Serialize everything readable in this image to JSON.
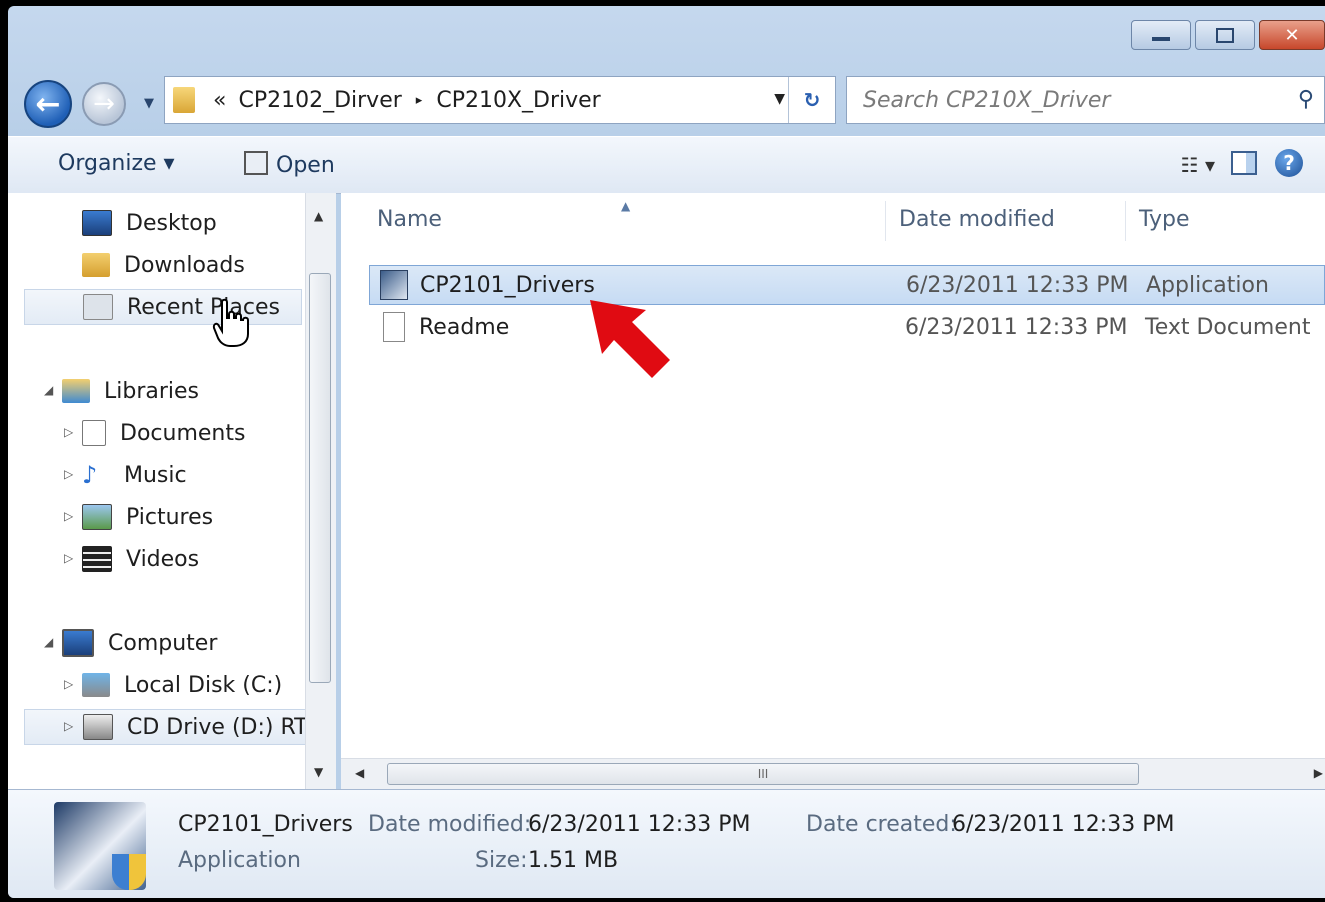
{
  "window": {
    "caption_buttons": {
      "minimize": "minimize",
      "maximize": "maximize",
      "close": "✕"
    }
  },
  "address_bar": {
    "overflow": "«",
    "crumbs": [
      "CP2102_Dirver",
      "CP210X_Driver"
    ],
    "separator": "▸"
  },
  "search": {
    "placeholder": "Search CP210X_Driver"
  },
  "toolbar": {
    "organize": "Organize ▾",
    "open": "Open",
    "help": "?"
  },
  "nav_pane": {
    "favorites": [
      {
        "label": "Desktop",
        "icon": "desktop-icon"
      },
      {
        "label": "Downloads",
        "icon": "downloads-icon"
      },
      {
        "label": "Recent Places",
        "icon": "recent-places-icon"
      }
    ],
    "libraries": {
      "label": "Libraries",
      "items": [
        "Documents",
        "Music",
        "Pictures",
        "Videos"
      ]
    },
    "computer": {
      "label": "Computer",
      "items": [
        "Local Disk (C:)",
        "CD Drive (D:) RTN"
      ]
    }
  },
  "columns": {
    "name": "Name",
    "date": "Date modified",
    "type": "Type"
  },
  "files": [
    {
      "name": "CP2101_Drivers",
      "date": "6/23/2011 12:33 PM",
      "type": "Application",
      "icon": "application-icon",
      "selected": true
    },
    {
      "name": "Readme",
      "date": "6/23/2011 12:33 PM",
      "type": "Text Document",
      "icon": "text-document-icon",
      "selected": false
    }
  ],
  "details": {
    "name": "CP2101_Drivers",
    "type": "Application",
    "date_modified_label": "Date modified:",
    "date_modified": "6/23/2011 12:33 PM",
    "date_created_label": "Date created:",
    "date_created": "6/23/2011 12:33 PM",
    "size_label": "Size:",
    "size": "1.51 MB"
  },
  "scrollbar": {
    "grip": "III"
  },
  "colors": {
    "accent": "#e00b12",
    "selection": "#c6dbf3"
  }
}
